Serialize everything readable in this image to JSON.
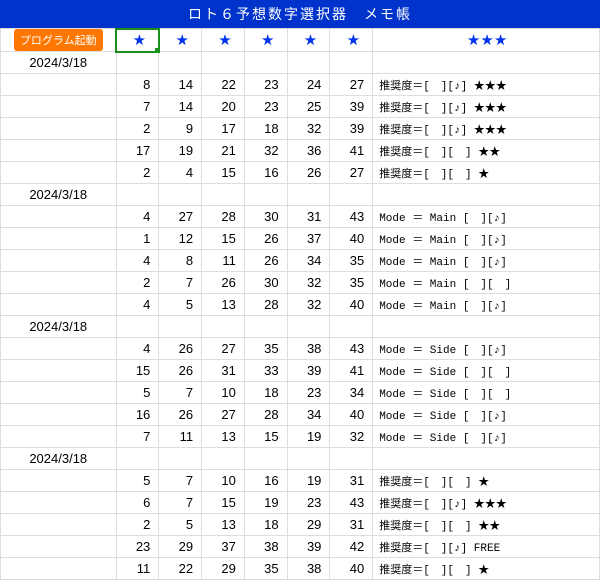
{
  "title": "ロト６予想数字選択器　メモ帳",
  "launch_label": "プログラム起動",
  "header_star": "★",
  "header_star_triple": "★★★",
  "groups": [
    {
      "date": "2024/3/18",
      "rows": [
        {
          "n": [
            8,
            14,
            22,
            23,
            24,
            27
          ],
          "note": "推奨度＝[　][♪] ★★★"
        },
        {
          "n": [
            7,
            14,
            20,
            23,
            25,
            39
          ],
          "note": "推奨度＝[　][♪] ★★★"
        },
        {
          "n": [
            2,
            9,
            17,
            18,
            32,
            39
          ],
          "note": "推奨度＝[　][♪] ★★★"
        },
        {
          "n": [
            17,
            19,
            21,
            32,
            36,
            41
          ],
          "note": "推奨度＝[　][　] ★★"
        },
        {
          "n": [
            2,
            4,
            15,
            16,
            26,
            27
          ],
          "note": "推奨度＝[　][　] ★"
        }
      ]
    },
    {
      "date": "2024/3/18",
      "rows": [
        {
          "n": [
            4,
            27,
            28,
            30,
            31,
            43
          ],
          "note": "Mode ＝ Main [　][♪]"
        },
        {
          "n": [
            1,
            12,
            15,
            26,
            37,
            40
          ],
          "note": "Mode ＝ Main [　][♪]"
        },
        {
          "n": [
            4,
            8,
            11,
            26,
            34,
            35
          ],
          "note": "Mode ＝ Main [　][♪]"
        },
        {
          "n": [
            2,
            7,
            26,
            30,
            32,
            35
          ],
          "note": "Mode ＝ Main [　][　]"
        },
        {
          "n": [
            4,
            5,
            13,
            28,
            32,
            40
          ],
          "note": "Mode ＝ Main [　][♪]"
        }
      ]
    },
    {
      "date": "2024/3/18",
      "rows": [
        {
          "n": [
            4,
            26,
            27,
            35,
            38,
            43
          ],
          "note": "Mode ＝ Side [　][♪]"
        },
        {
          "n": [
            15,
            26,
            31,
            33,
            39,
            41
          ],
          "note": "Mode ＝ Side [　][　]"
        },
        {
          "n": [
            5,
            7,
            10,
            18,
            23,
            34
          ],
          "note": "Mode ＝ Side [　][　]"
        },
        {
          "n": [
            16,
            26,
            27,
            28,
            34,
            40
          ],
          "note": "Mode ＝ Side [　][♪]"
        },
        {
          "n": [
            7,
            11,
            13,
            15,
            19,
            32
          ],
          "note": "Mode ＝ Side [　][♪]"
        }
      ]
    },
    {
      "date": "2024/3/18",
      "rows": [
        {
          "n": [
            5,
            7,
            10,
            16,
            19,
            31
          ],
          "note": "推奨度＝[　][　] ★"
        },
        {
          "n": [
            6,
            7,
            15,
            19,
            23,
            43
          ],
          "note": "推奨度＝[　][♪] ★★★"
        },
        {
          "n": [
            2,
            5,
            13,
            18,
            29,
            31
          ],
          "note": "推奨度＝[　][　] ★★"
        },
        {
          "n": [
            23,
            29,
            37,
            38,
            39,
            42
          ],
          "note": "推奨度＝[　][♪] FREE"
        },
        {
          "n": [
            11,
            22,
            29,
            35,
            38,
            40
          ],
          "note": "推奨度＝[　][　] ★"
        }
      ]
    }
  ]
}
